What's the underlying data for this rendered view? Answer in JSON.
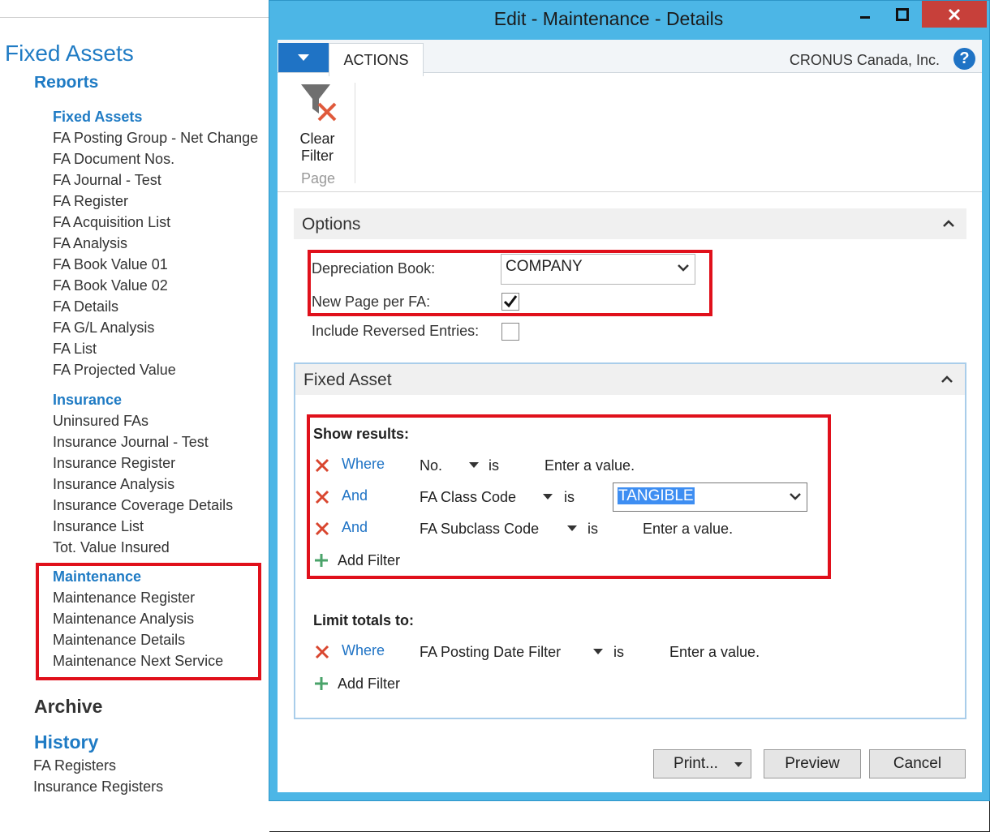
{
  "navigation": {
    "app_title": "Fixed Assets",
    "cut_heading": "Reports",
    "fixed_assets_group": "Fixed Assets",
    "fixed_assets_items": [
      "FA Posting Group - Net Change",
      "FA Document Nos.",
      "FA Journal - Test",
      "FA Register",
      "FA Acquisition List",
      "FA Analysis",
      "FA Book Value 01",
      "FA Book Value 02",
      "FA Details",
      "FA G/L Analysis",
      "FA List",
      "FA Projected Value"
    ],
    "insurance_group": "Insurance",
    "insurance_items": [
      "Uninsured FAs",
      "Insurance Journal - Test",
      "Insurance Register",
      "Insurance Analysis",
      "Insurance Coverage Details",
      "Insurance List",
      "Tot. Value Insured"
    ],
    "maintenance_group": "Maintenance",
    "maintenance_items": [
      "Maintenance Register",
      "Maintenance Analysis",
      "Maintenance Details",
      "Maintenance Next Service"
    ],
    "archive_heading": "Archive",
    "history_heading": "History",
    "history_items": [
      "FA Registers",
      "Insurance Registers"
    ]
  },
  "dialog": {
    "title": "Edit - Maintenance - Details",
    "window_buttons": {
      "minimize": "▬",
      "maximize": "□",
      "close": "✕"
    },
    "ribbon": {
      "tab": "ACTIONS",
      "company": "CRONUS Canada, Inc.",
      "help": "?",
      "clear_filter_line1": "Clear",
      "clear_filter_line2": "Filter",
      "group_label": "Page"
    },
    "options": {
      "header": "Options",
      "depreciation_book_label": "Depreciation Book:",
      "depreciation_book_value": "COMPANY",
      "new_page_label": "New Page per FA:",
      "new_page_checked": true,
      "include_reversed_label": "Include Reversed Entries:",
      "include_reversed_checked": false
    },
    "fixed_asset": {
      "header": "Fixed Asset",
      "show_results_label": "Show results:",
      "filters": [
        {
          "conj": "Where",
          "field": "No.",
          "op": "is",
          "value": "Enter a value."
        },
        {
          "conj": "And",
          "field": "FA Class Code",
          "op": "is",
          "value": "TANGIBLE"
        },
        {
          "conj": "And",
          "field": "FA Subclass Code",
          "op": "is",
          "value": "Enter a value."
        }
      ],
      "add_filter": "Add Filter",
      "limit_totals_label": "Limit totals to:",
      "limit_filters": [
        {
          "conj": "Where",
          "field": "FA Posting Date Filter",
          "op": "is",
          "value": "Enter a value."
        }
      ],
      "limit_add_filter": "Add Filter"
    },
    "buttons": {
      "print": "Print...",
      "preview": "Preview",
      "cancel": "Cancel"
    }
  },
  "colors": {
    "accent": "#1f73c5",
    "link": "#1f7bc4",
    "highlight": "#e0101b",
    "title_bar": "#4cb6e6",
    "close_button": "#c7403a"
  }
}
